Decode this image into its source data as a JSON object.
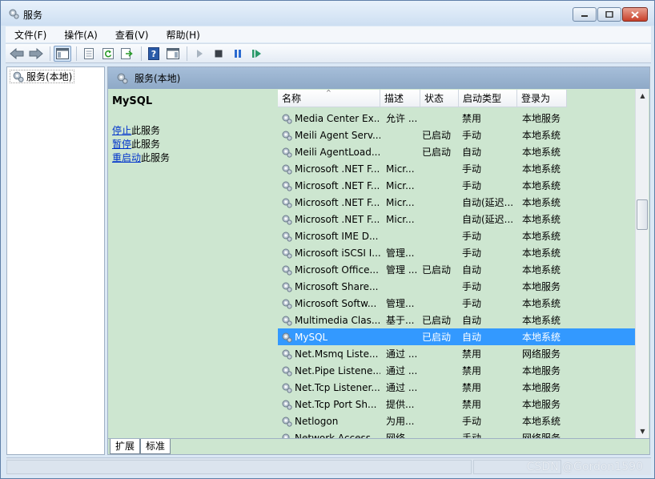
{
  "window": {
    "title": "服务",
    "buttons": {
      "minimize": "minimize",
      "maximize": "maximize",
      "close": "close"
    }
  },
  "menu": [
    "文件(F)",
    "操作(A)",
    "查看(V)",
    "帮助(H)"
  ],
  "toolbar": {
    "icons": [
      "back-icon",
      "forward-icon",
      "show-hide-tree-icon",
      "properties-icon",
      "refresh-icon",
      "export-list-icon",
      "help-icon",
      "show-hide-action-pane-icon",
      "start-service-icon",
      "stop-service-icon",
      "pause-service-icon",
      "resume-service-icon"
    ]
  },
  "tree": {
    "root_label": "服务(本地)"
  },
  "pane": {
    "header": "服务(本地)",
    "selected_service": "MySQL",
    "actions": [
      {
        "link": "停止",
        "suffix": "此服务"
      },
      {
        "link": "暂停",
        "suffix": "此服务"
      },
      {
        "link": "重启动",
        "suffix": "此服务"
      }
    ]
  },
  "columns": {
    "name": "名称",
    "desc": "描述",
    "status": "状态",
    "startup": "启动类型",
    "logon": "登录为"
  },
  "services": [
    {
      "name": "Media Center Ex...",
      "desc": "允许 ...",
      "status": "",
      "startup": "禁用",
      "logon": "本地服务"
    },
    {
      "name": "Meili Agent Serv...",
      "desc": "",
      "status": "已启动",
      "startup": "手动",
      "logon": "本地系统"
    },
    {
      "name": "Meili AgentLoad...",
      "desc": "",
      "status": "已启动",
      "startup": "自动",
      "logon": "本地系统"
    },
    {
      "name": "Microsoft .NET F...",
      "desc": "Micr...",
      "status": "",
      "startup": "手动",
      "logon": "本地系统"
    },
    {
      "name": "Microsoft .NET F...",
      "desc": "Micr...",
      "status": "",
      "startup": "手动",
      "logon": "本地系统"
    },
    {
      "name": "Microsoft .NET F...",
      "desc": "Micr...",
      "status": "",
      "startup": "自动(延迟...",
      "logon": "本地系统"
    },
    {
      "name": "Microsoft .NET F...",
      "desc": "Micr...",
      "status": "",
      "startup": "自动(延迟...",
      "logon": "本地系统"
    },
    {
      "name": "Microsoft IME D...",
      "desc": "",
      "status": "",
      "startup": "手动",
      "logon": "本地系统"
    },
    {
      "name": "Microsoft iSCSI I...",
      "desc": "管理...",
      "status": "",
      "startup": "手动",
      "logon": "本地系统"
    },
    {
      "name": "Microsoft Office...",
      "desc": "管理 ...",
      "status": "已启动",
      "startup": "自动",
      "logon": "本地系统"
    },
    {
      "name": "Microsoft Share...",
      "desc": "",
      "status": "",
      "startup": "手动",
      "logon": "本地服务"
    },
    {
      "name": "Microsoft Softw...",
      "desc": "管理...",
      "status": "",
      "startup": "手动",
      "logon": "本地系统"
    },
    {
      "name": "Multimedia Clas...",
      "desc": "基于...",
      "status": "已启动",
      "startup": "自动",
      "logon": "本地系统"
    },
    {
      "name": "MySQL",
      "desc": "",
      "status": "已启动",
      "startup": "自动",
      "logon": "本地系统",
      "selected": true
    },
    {
      "name": "Net.Msmq Liste...",
      "desc": "通过 ...",
      "status": "",
      "startup": "禁用",
      "logon": "网络服务"
    },
    {
      "name": "Net.Pipe Listene...",
      "desc": "通过 ...",
      "status": "",
      "startup": "禁用",
      "logon": "本地服务"
    },
    {
      "name": "Net.Tcp Listener...",
      "desc": "通过 ...",
      "status": "",
      "startup": "禁用",
      "logon": "本地服务"
    },
    {
      "name": "Net.Tcp Port Sh...",
      "desc": "提供...",
      "status": "",
      "startup": "禁用",
      "logon": "本地服务"
    },
    {
      "name": "Netlogon",
      "desc": "为用...",
      "status": "",
      "startup": "手动",
      "logon": "本地系统"
    },
    {
      "name": "Network Access ...",
      "desc": "网络...",
      "status": "",
      "startup": "手动",
      "logon": "网络服务"
    }
  ],
  "tabs": [
    "扩展",
    "标准"
  ],
  "watermark": "CSDN @Gordon1590"
}
